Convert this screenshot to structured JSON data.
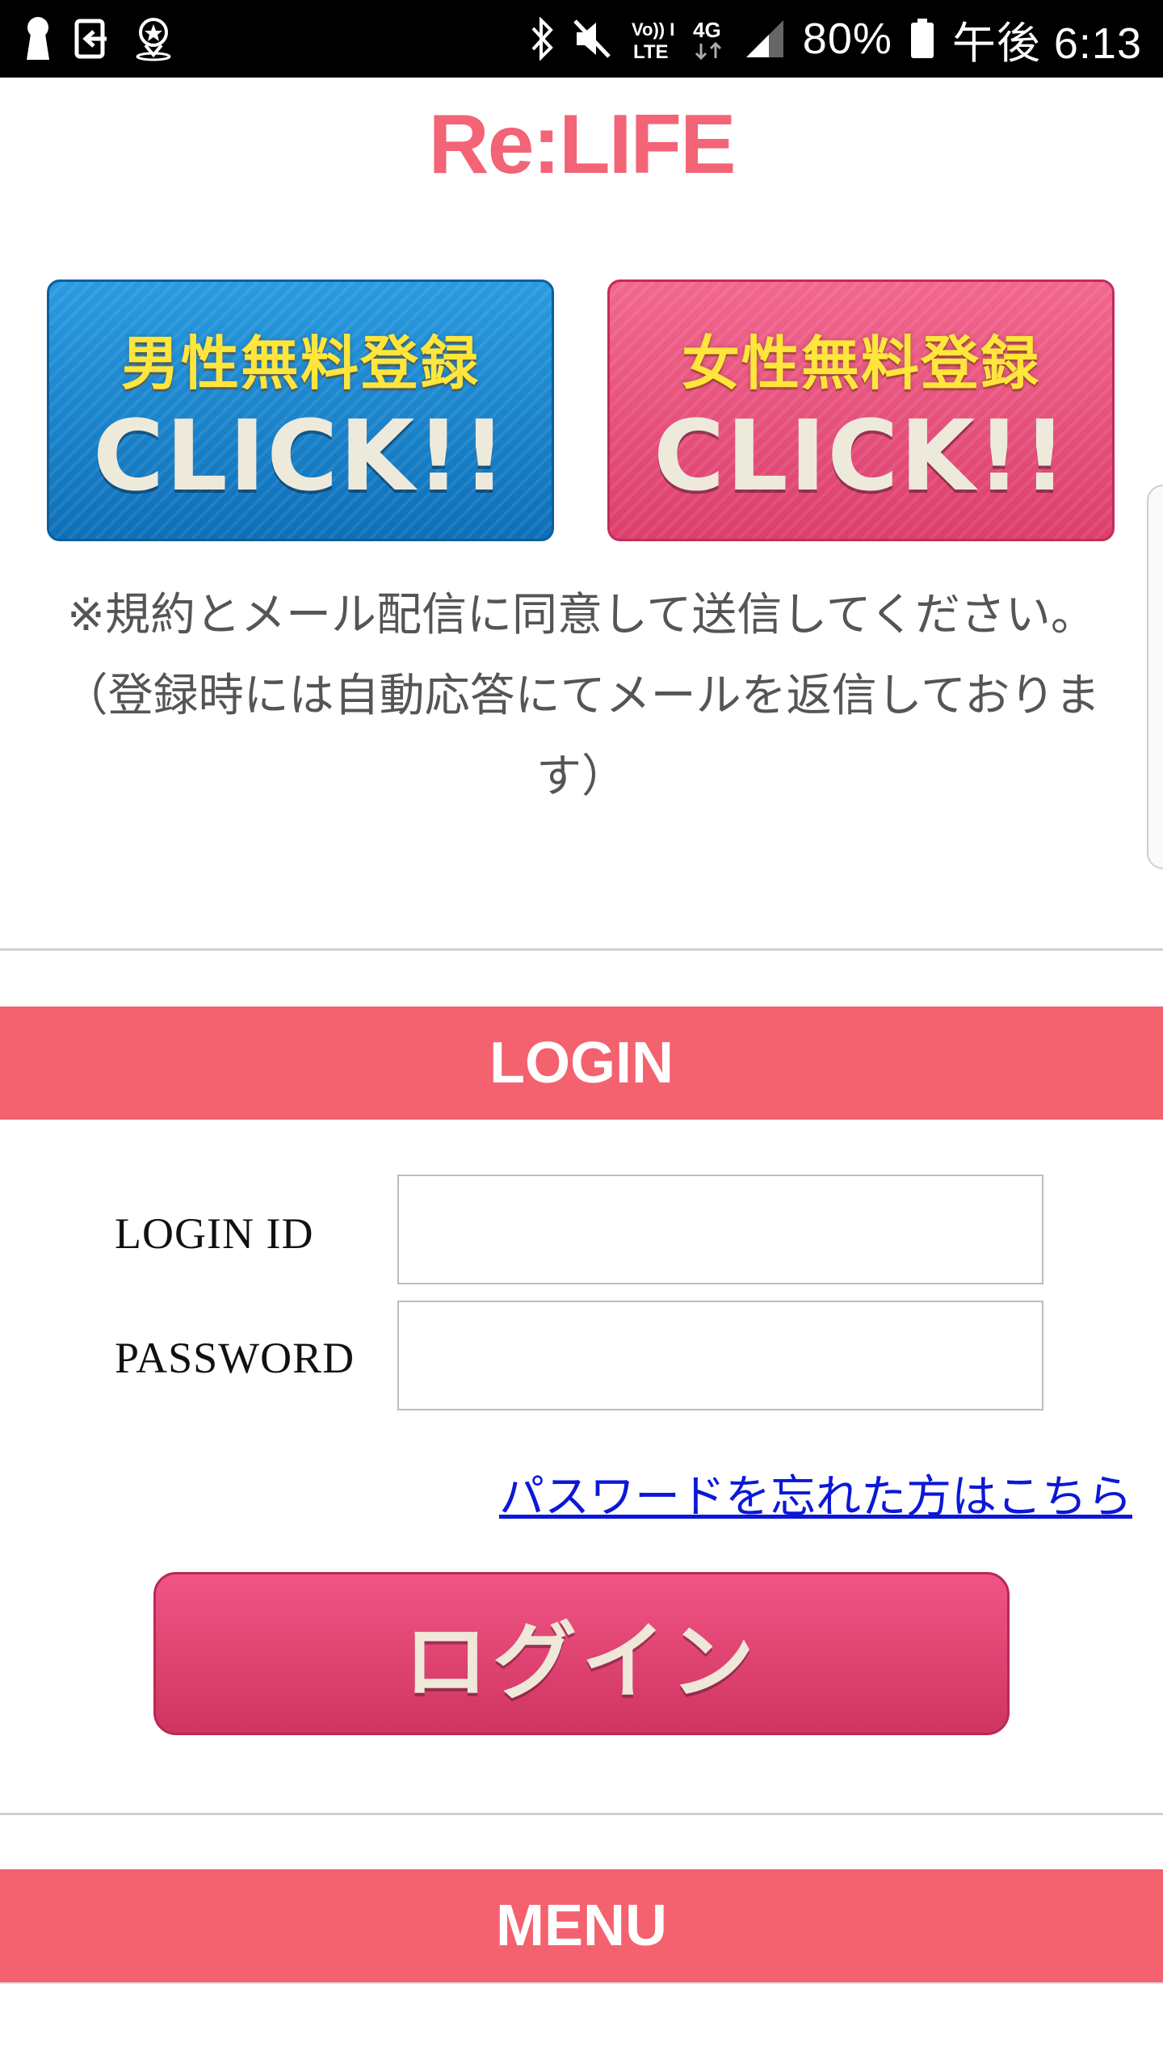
{
  "status_bar": {
    "battery": "80%",
    "time": "午後 6:13",
    "network": "4G",
    "volte": "Vo)) LTE",
    "icons": [
      "keyhole-icon",
      "exit-app-icon",
      "location-star-icon",
      "bluetooth-icon",
      "mute-icon",
      "volte-icon",
      "network-4g-icon",
      "signal-icon",
      "battery-icon"
    ]
  },
  "brand": {
    "logo": "Re:LIFE",
    "color": "#f36476"
  },
  "register": {
    "male_title": "男性無料登録",
    "male_click": "CLICK!!",
    "female_title": "女性無料登録",
    "female_click": "CLICK!!"
  },
  "notice": {
    "line1": "※規約とメール配信に同意して送信してください。",
    "line2": "（登録時には自動応答にてメールを返信しております）"
  },
  "login": {
    "header": "LOGIN",
    "id_label": "LOGIN ID",
    "id_value": "",
    "password_label": "PASSWORD",
    "password_value": "",
    "forgot_link": "パスワードを忘れた方はこちら",
    "button_label": "ログイン"
  },
  "menu": {
    "header": "MENU"
  },
  "colors": {
    "section_header": "#f4616f",
    "male_button": "#1a84cc",
    "female_button": "#e84d78",
    "link": "#0b18d8"
  }
}
